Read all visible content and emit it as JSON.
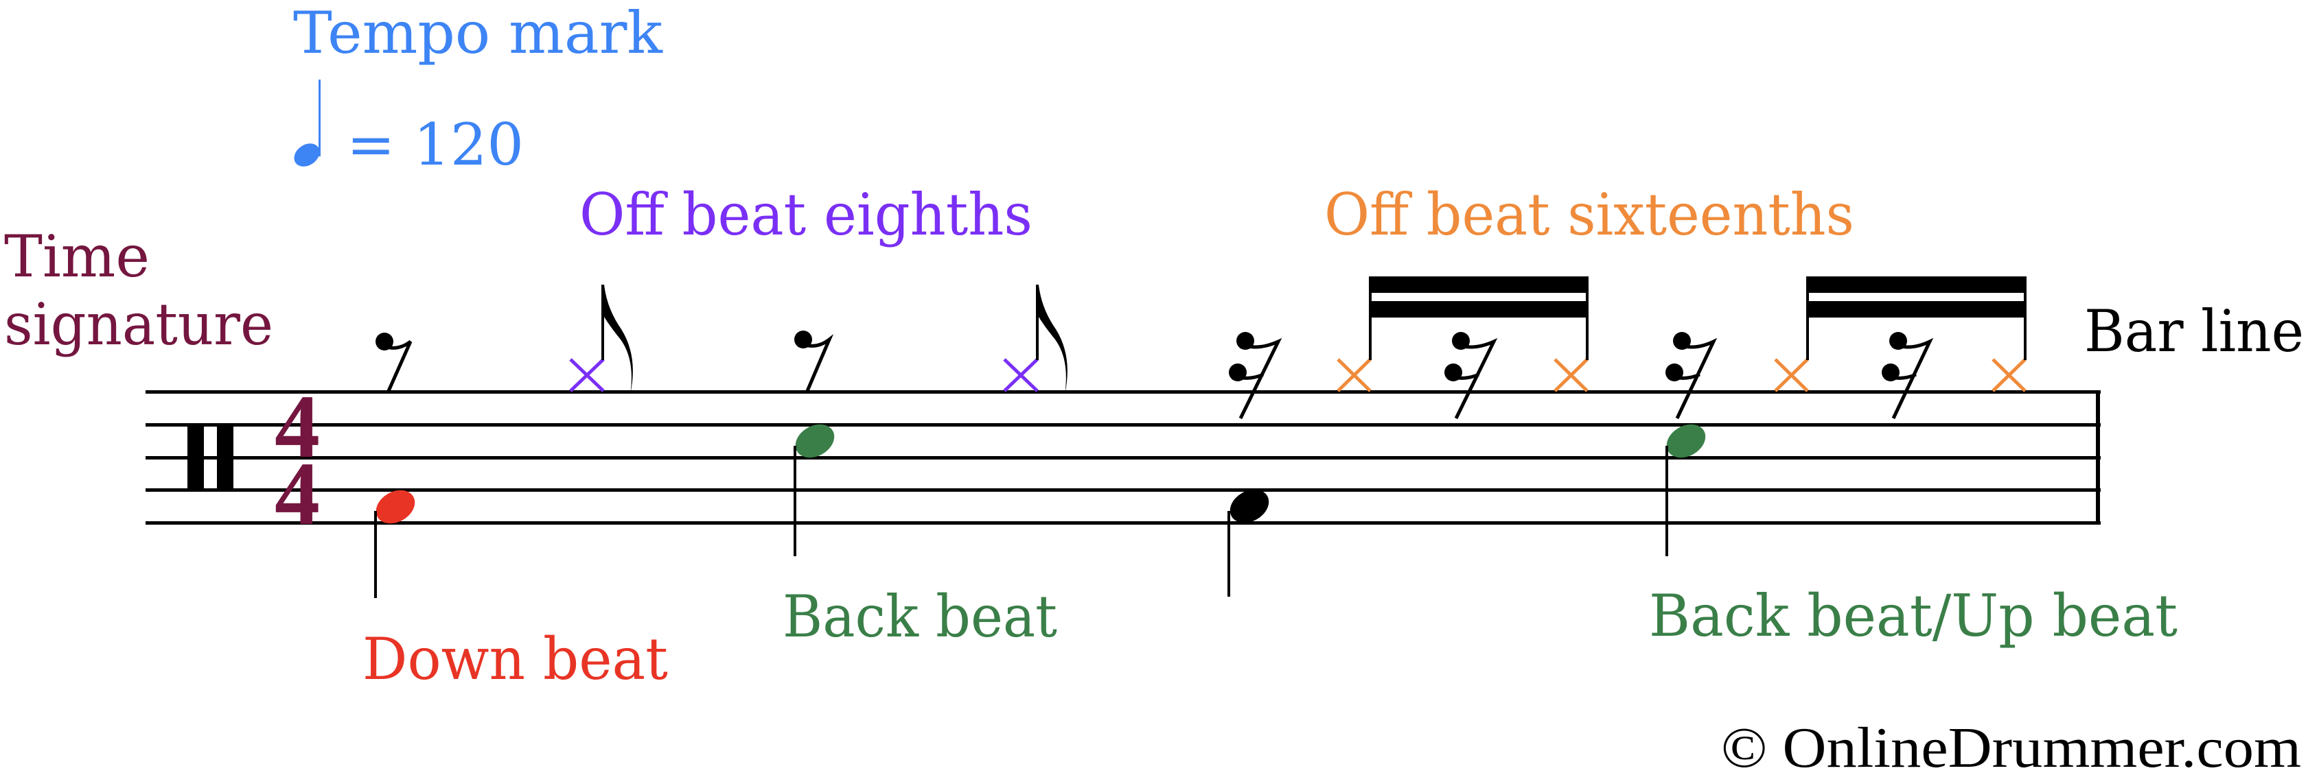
{
  "labels": {
    "tempo_mark": "Tempo mark",
    "tempo_value": "= 120",
    "time_signature_line1": "Time",
    "time_signature_line2": "signature",
    "off_beat_eighths": "Off beat eighths",
    "off_beat_sixteenths": "Off beat sixteenths",
    "bar_line": "Bar line",
    "down_beat": "Down beat",
    "back_beat": "Back beat",
    "back_beat_up_beat": "Back beat/Up beat",
    "copyright": "© OnlineDrummer.com"
  },
  "time_signature": {
    "numerator": "4",
    "denominator": "4"
  },
  "tempo": {
    "note": "quarter",
    "bpm": 120
  },
  "colors": {
    "tempo": "#3d84f5",
    "time_signature": "#74163f",
    "off_beat_eighths": "#7a2ff5",
    "off_beat_sixteenths": "#ef8b3b",
    "back_beat": "#3a7f48",
    "down_beat": "#e83425",
    "ink": "#000000"
  },
  "measure": {
    "beats": [
      {
        "beat": 1,
        "instrument": "bass-drum",
        "color_key": "down_beat",
        "hihat": "eighth-offbeat"
      },
      {
        "beat": 2,
        "instrument": "snare",
        "color_key": "back_beat",
        "hihat": "eighth-offbeat"
      },
      {
        "beat": 3,
        "instrument": "bass-drum",
        "color_key": "ink",
        "hihat": "sixteenth-offbeats"
      },
      {
        "beat": 4,
        "instrument": "snare",
        "color_key": "back_beat",
        "hihat": "sixteenth-offbeats"
      }
    ]
  }
}
